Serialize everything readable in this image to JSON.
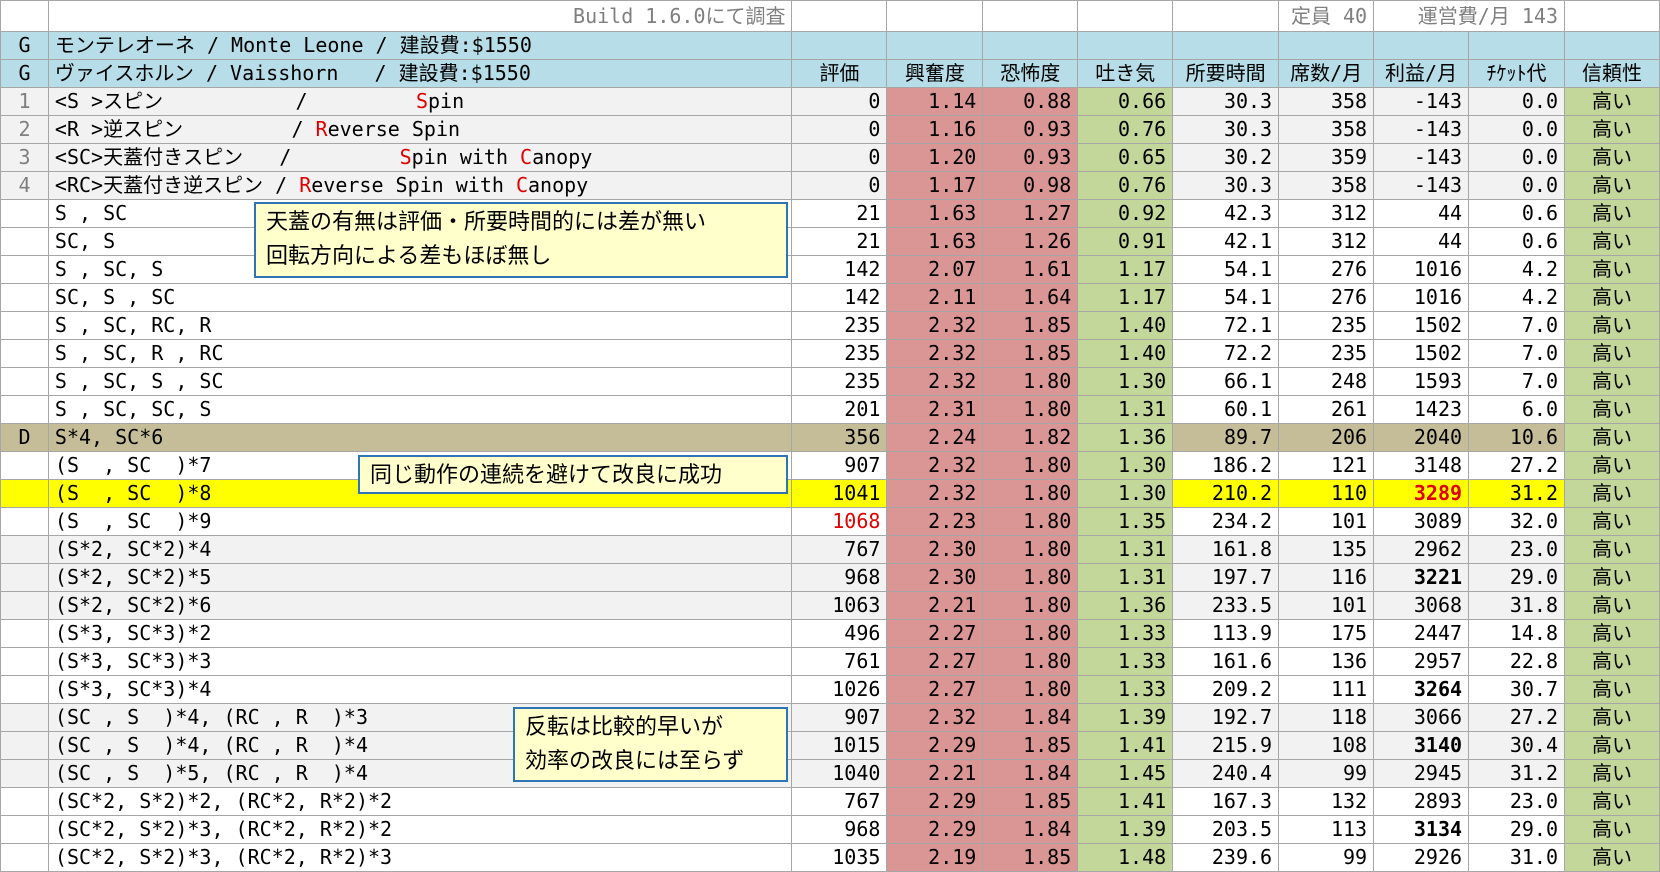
{
  "top": {
    "note": "Build 1.6.0にて調査",
    "capacity": "定員 40",
    "upkeep": "運営費/月 143"
  },
  "rides": [
    {
      "idx": "G",
      "name": "モンテレオーネ / Monte Leone / 建設費:$1550"
    },
    {
      "idx": "G",
      "name": "ヴァイスホルン / Vaisshorn   / 建設費:$1550"
    }
  ],
  "headers": [
    "評価",
    "興奮度",
    "恐怖度",
    "吐き気",
    "所要時間",
    "席数/月",
    "利益/月",
    "ﾁｹｯﾄ代",
    "信頼性"
  ],
  "rows": [
    {
      "idx": "1",
      "style": "gray",
      "name": [
        [
          "<S >スピン           /         ",
          0
        ],
        [
          "S",
          1
        ],
        [
          "pin",
          0
        ]
      ],
      "v": [
        "0",
        "1.14",
        "0.88",
        "0.66",
        "30.3",
        "358",
        "-143",
        "0.0",
        "高い"
      ]
    },
    {
      "idx": "2",
      "style": "gray",
      "name": [
        [
          "<R >逆スピン         / ",
          0
        ],
        [
          "R",
          1
        ],
        [
          "everse Spin",
          0
        ]
      ],
      "v": [
        "0",
        "1.16",
        "0.93",
        "0.76",
        "30.3",
        "358",
        "-143",
        "0.0",
        "高い"
      ]
    },
    {
      "idx": "3",
      "style": "gray",
      "name": [
        [
          "<SC>天蓋付きスピン   /         ",
          0
        ],
        [
          "S",
          1
        ],
        [
          "pin with ",
          0
        ],
        [
          "C",
          1
        ],
        [
          "anopy",
          0
        ]
      ],
      "v": [
        "0",
        "1.20",
        "0.93",
        "0.65",
        "30.2",
        "359",
        "-143",
        "0.0",
        "高い"
      ]
    },
    {
      "idx": "4",
      "style": "gray",
      "name": [
        [
          "<RC>天蓋付き逆スピン / ",
          0
        ],
        [
          "R",
          1
        ],
        [
          "everse Spin with ",
          0
        ],
        [
          "C",
          1
        ],
        [
          "anopy",
          0
        ]
      ],
      "v": [
        "0",
        "1.17",
        "0.98",
        "0.76",
        "30.3",
        "358",
        "-143",
        "0.0",
        "高い"
      ]
    },
    {
      "idx": "",
      "style": "",
      "name": [
        [
          "S , SC",
          0
        ]
      ],
      "v": [
        "21",
        "1.63",
        "1.27",
        "0.92",
        "42.3",
        "312",
        "44",
        "0.6",
        "高い"
      ]
    },
    {
      "idx": "",
      "style": "",
      "name": [
        [
          "SC, S",
          0
        ]
      ],
      "v": [
        "21",
        "1.63",
        "1.26",
        "0.91",
        "42.1",
        "312",
        "44",
        "0.6",
        "高い"
      ]
    },
    {
      "idx": "",
      "style": "",
      "name": [
        [
          "S , SC, S",
          0
        ]
      ],
      "v": [
        "142",
        "2.07",
        "1.61",
        "1.17",
        "54.1",
        "276",
        "1016",
        "4.2",
        "高い"
      ]
    },
    {
      "idx": "",
      "style": "",
      "name": [
        [
          "SC, S , SC",
          0
        ]
      ],
      "v": [
        "142",
        "2.11",
        "1.64",
        "1.17",
        "54.1",
        "276",
        "1016",
        "4.2",
        "高い"
      ]
    },
    {
      "idx": "",
      "style": "",
      "name": [
        [
          "S , SC, RC, R",
          0
        ]
      ],
      "v": [
        "235",
        "2.32",
        "1.85",
        "1.40",
        "72.1",
        "235",
        "1502",
        "7.0",
        "高い"
      ]
    },
    {
      "idx": "",
      "style": "",
      "name": [
        [
          "S , SC, R , RC",
          0
        ]
      ],
      "v": [
        "235",
        "2.32",
        "1.85",
        "1.40",
        "72.2",
        "235",
        "1502",
        "7.0",
        "高い"
      ]
    },
    {
      "idx": "",
      "style": "",
      "name": [
        [
          "S , SC, S , SC",
          0
        ]
      ],
      "v": [
        "235",
        "2.32",
        "1.80",
        "1.30",
        "66.1",
        "248",
        "1593",
        "7.0",
        "高い"
      ]
    },
    {
      "idx": "",
      "style": "",
      "name": [
        [
          "S , SC, SC, S",
          0
        ]
      ],
      "v": [
        "201",
        "2.31",
        "1.80",
        "1.31",
        "60.1",
        "261",
        "1423",
        "6.0",
        "高い"
      ]
    },
    {
      "idx": "D",
      "style": "d",
      "name": [
        [
          "S*4, SC*6",
          0
        ]
      ],
      "v": [
        "356",
        "2.24",
        "1.82",
        "1.36",
        "89.7",
        "206",
        "2040",
        "10.6",
        "高い"
      ]
    },
    {
      "idx": "",
      "style": "",
      "name": [
        [
          "(S  , SC  )*7",
          0
        ]
      ],
      "v": [
        "907",
        "2.32",
        "1.80",
        "1.30",
        "186.2",
        "121",
        "3148",
        "27.2",
        "高い"
      ]
    },
    {
      "idx": "",
      "style": "y",
      "name": [
        [
          "(S  , SC  )*8",
          0
        ]
      ],
      "v": [
        "1041",
        "2.32",
        "1.80",
        "1.30",
        "210.2",
        "110",
        "3289",
        "31.2",
        "高い"
      ],
      "profit_emph": "red-bold"
    },
    {
      "idx": "",
      "style": "",
      "name": [
        [
          "(S  , SC  )*9",
          0
        ]
      ],
      "v": [
        "1068",
        "2.23",
        "1.80",
        "1.35",
        "234.2",
        "101",
        "3089",
        "32.0",
        "高い"
      ],
      "rating_emph": "red"
    },
    {
      "idx": "",
      "style": "gray",
      "name": [
        [
          "(S*2, SC*2)*4",
          0
        ]
      ],
      "v": [
        "767",
        "2.30",
        "1.80",
        "1.31",
        "161.8",
        "135",
        "2962",
        "23.0",
        "高い"
      ]
    },
    {
      "idx": "",
      "style": "gray",
      "name": [
        [
          "(S*2, SC*2)*5",
          0
        ]
      ],
      "v": [
        "968",
        "2.30",
        "1.80",
        "1.31",
        "197.7",
        "116",
        "3221",
        "29.0",
        "高い"
      ],
      "profit_emph": "bold"
    },
    {
      "idx": "",
      "style": "gray",
      "name": [
        [
          "(S*2, SC*2)*6",
          0
        ]
      ],
      "v": [
        "1063",
        "2.21",
        "1.80",
        "1.36",
        "233.5",
        "101",
        "3068",
        "31.8",
        "高い"
      ]
    },
    {
      "idx": "",
      "style": "",
      "name": [
        [
          "(S*3, SC*3)*2",
          0
        ]
      ],
      "v": [
        "496",
        "2.27",
        "1.80",
        "1.33",
        "113.9",
        "175",
        "2447",
        "14.8",
        "高い"
      ]
    },
    {
      "idx": "",
      "style": "",
      "name": [
        [
          "(S*3, SC*3)*3",
          0
        ]
      ],
      "v": [
        "761",
        "2.27",
        "1.80",
        "1.33",
        "161.6",
        "136",
        "2957",
        "22.8",
        "高い"
      ]
    },
    {
      "idx": "",
      "style": "",
      "name": [
        [
          "(S*3, SC*3)*4",
          0
        ]
      ],
      "v": [
        "1026",
        "2.27",
        "1.80",
        "1.33",
        "209.2",
        "111",
        "3264",
        "30.7",
        "高い"
      ],
      "profit_emph": "bold"
    },
    {
      "idx": "",
      "style": "gray",
      "name": [
        [
          "(SC , S  )*4, (RC , R  )*3",
          0
        ]
      ],
      "v": [
        "907",
        "2.32",
        "1.84",
        "1.39",
        "192.7",
        "118",
        "3066",
        "27.2",
        "高い"
      ]
    },
    {
      "idx": "",
      "style": "gray",
      "name": [
        [
          "(SC , S  )*4, (RC , R  )*4",
          0
        ]
      ],
      "v": [
        "1015",
        "2.29",
        "1.85",
        "1.41",
        "215.9",
        "108",
        "3140",
        "30.4",
        "高い"
      ],
      "profit_emph": "bold"
    },
    {
      "idx": "",
      "style": "gray",
      "name": [
        [
          "(SC , S  )*5, (RC , R  )*4",
          0
        ]
      ],
      "v": [
        "1040",
        "2.21",
        "1.84",
        "1.45",
        "240.4",
        "99",
        "2945",
        "31.2",
        "高い"
      ]
    },
    {
      "idx": "",
      "style": "",
      "name": [
        [
          "(SC*2, S*2)*2, (RC*2, R*2)*2",
          0
        ]
      ],
      "v": [
        "767",
        "2.29",
        "1.85",
        "1.41",
        "167.3",
        "132",
        "2893",
        "23.0",
        "高い"
      ]
    },
    {
      "idx": "",
      "style": "",
      "name": [
        [
          "(SC*2, S*2)*3, (RC*2, R*2)*2",
          0
        ]
      ],
      "v": [
        "968",
        "2.29",
        "1.84",
        "1.39",
        "203.5",
        "113",
        "3134",
        "29.0",
        "高い"
      ],
      "profit_emph": "bold"
    },
    {
      "idx": "",
      "style": "",
      "name": [
        [
          "(SC*2, S*2)*3, (RC*2, R*2)*3",
          0
        ]
      ],
      "v": [
        "1035",
        "2.19",
        "1.85",
        "1.48",
        "239.6",
        "99",
        "2926",
        "31.0",
        "高い"
      ]
    }
  ],
  "callouts": [
    {
      "lines": [
        "天蓋の有無は評価・所要時間的には差が無い",
        "回転方向による差もほぼ無し"
      ]
    },
    {
      "lines": [
        "同じ動作の連続を避けて改良に成功"
      ]
    },
    {
      "lines": [
        "反転は比較的早いが",
        "効率の改良には至らず"
      ]
    }
  ]
}
